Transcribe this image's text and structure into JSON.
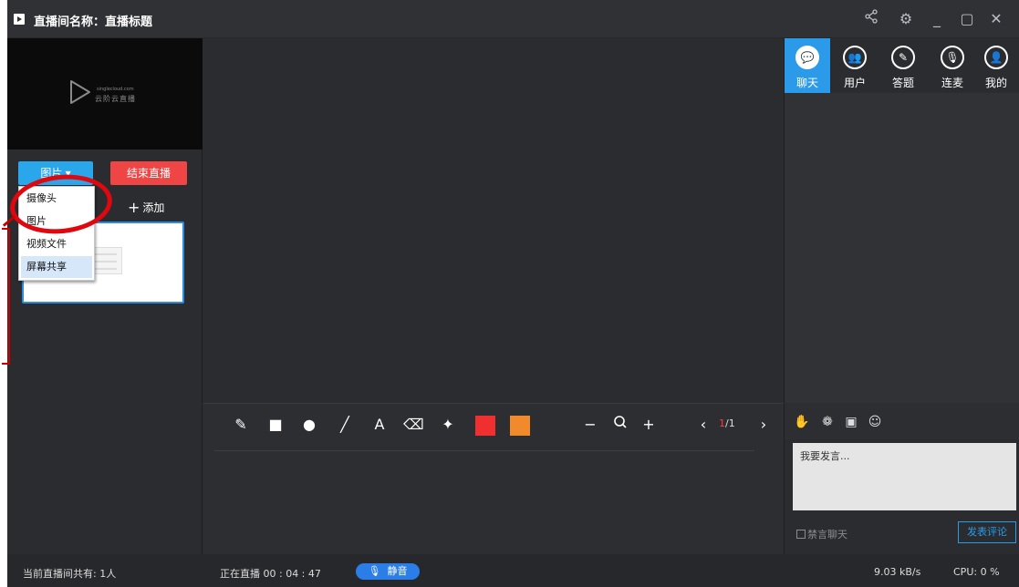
{
  "titlebar": {
    "title": "直播间名称：直播标题",
    "icons": [
      "share-icon",
      "gear-icon",
      "minimize-icon",
      "maximize-icon",
      "close-icon"
    ]
  },
  "left": {
    "preview": {
      "logo_small": "singlecloud.com",
      "logo_text": "云阶云直播"
    },
    "source_button": "图片 ▾",
    "end_button": "结束直播",
    "add_button": "添加",
    "dropdown": {
      "items": [
        "摄像头",
        "图片",
        "视频文件",
        "屏幕共享"
      ],
      "highlighted": "屏幕共享"
    }
  },
  "toolbar": {
    "tools": [
      "pencil-icon",
      "rectangle-icon",
      "circle-icon",
      "line-icon",
      "text-icon",
      "eraser-icon",
      "clear-icon"
    ],
    "text_tool_label": "A",
    "colors": {
      "primary": "#f03030",
      "secondary": "#f08a2a"
    },
    "zoom_minus": "−",
    "zoom_plus": "+",
    "prev": "‹",
    "next": "›",
    "page_current": "1",
    "page_total": "/1"
  },
  "right": {
    "tabs": [
      {
        "label": "聊天",
        "icon": "chat-icon",
        "glyph": "💬"
      },
      {
        "label": "用户",
        "icon": "users-icon",
        "glyph": "👥"
      },
      {
        "label": "答题",
        "icon": "pencil-circle-icon",
        "glyph": "✎"
      },
      {
        "label": "连麦",
        "icon": "mic-icon",
        "glyph": "🎙"
      },
      {
        "label": "我的",
        "icon": "user-icon",
        "glyph": "👤"
      }
    ],
    "chat_placeholder": "我要发言...",
    "mute_chat": "禁言聊天",
    "send_button": "发表评论"
  },
  "status": {
    "viewers": "当前直播间共有: 1人",
    "live_time": "正在直播 00 : 04 : 47",
    "mute_button": "静音",
    "bandwidth": "9.03 kB/s",
    "cpu": "CPU:  0 %"
  }
}
